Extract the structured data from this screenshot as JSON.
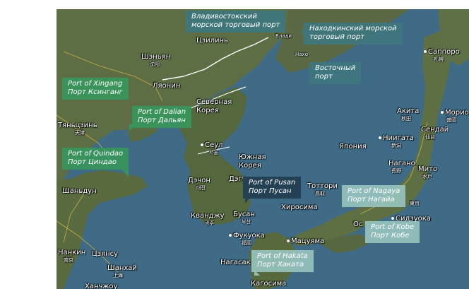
{
  "map": {
    "colors": {
      "sea": "#3f6b86",
      "land": "#5d6e45",
      "land_dark": "#4a5a34",
      "border": "#ffffff",
      "road": "#c8b040"
    },
    "places": {
      "shenyang": "Шэньян",
      "shenyang_cn": "沈阳",
      "tszilin": "Цзилинь",
      "lyaonin": "Ляонин",
      "tyantszin": "Тяньцзинь",
      "tyantszin_cn": "天津",
      "shandun": "Шаньдун",
      "nankin": "Нанкин",
      "nankin_cn": "南京",
      "tszyanksu": "Цзянсу",
      "shanhai": "Шанхай",
      "shanhai_cn": "上海",
      "hanchzhou": "Ханчжоу",
      "north_korea": "Северная Корея",
      "seoul": "Сеул",
      "seoul_cn": "서울",
      "south_korea": "Южная Корея",
      "daechon": "Дэчон",
      "daechon_cn": "대전",
      "daegu": "Дэгу",
      "kwangju": "Кванджу",
      "kwangju_cn": "광주",
      "busan": "Бусан",
      "busan_cn": "부산",
      "fukuoka": "Фукуока",
      "fukuoka_cn": "福岡",
      "nagasaki": "Нагасак",
      "kagoshima": "Кагосима",
      "hiroshima": "Хиросима",
      "matsuyama": "Мацуяма",
      "tottori": "Тоттори",
      "tottori_cn": "鳥取",
      "osaka": "Ос",
      "shizuoka": "Сидзуока",
      "nagano": "Нагано",
      "nagano_cn": "長野",
      "niigata": "Ниигата",
      "niigata_cn": "新潟",
      "mito": "Мито",
      "mito_cn": "水戸",
      "tokyo_cn": "東京",
      "akita": "Акита",
      "akita_cn": "秋田",
      "morioka": "Морио",
      "morioka_cn": "盛岡",
      "sendai": "Сендай",
      "sendai_cn": "仙台",
      "sapporo": "Саппоро",
      "sapporo_cn": "札幌",
      "japan": "Япония",
      "vladivostok_small": "Влади",
      "nakhodka_small": "Нахо"
    },
    "callouts": {
      "vladivostok": [
        "Владивостокский",
        "морской торговый порт"
      ],
      "nakhodka": [
        "Находкинский морской",
        "торговый порт"
      ],
      "vostochny": [
        "Восточный",
        "порт"
      ],
      "xingang": [
        "Port of Xingang",
        "Порт Ксинганг"
      ],
      "dalian": [
        "Port of Dalian",
        "Порт Дальян"
      ],
      "quindao": [
        "Port of Quindao",
        "Порт Циндао"
      ],
      "pusan": [
        "Port of Pusan",
        "Порт Пусан"
      ],
      "nagaya": [
        "Port of Nagaya",
        "Порт Нагайа"
      ],
      "kobe": [
        "Port of Kobe",
        "Порт Кобе"
      ],
      "hakata": [
        "Port of Hakata",
        "Порт Хаката"
      ]
    }
  }
}
